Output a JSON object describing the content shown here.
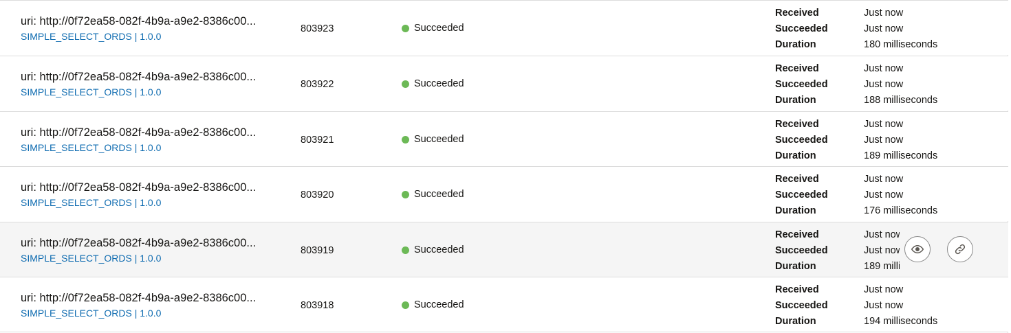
{
  "rows": [
    {
      "uri": "uri: http://0f72ea58-082f-4b9a-a9e2-8386c00...",
      "module": "SIMPLE_SELECT_ORDS | 1.0.0",
      "id": "803923",
      "status": "Succeeded",
      "received_label": "Received",
      "received": "Just now",
      "succeeded_label": "Succeeded",
      "succeeded": "Just now",
      "duration_label": "Duration",
      "duration": "180 milliseconds"
    },
    {
      "uri": "uri: http://0f72ea58-082f-4b9a-a9e2-8386c00...",
      "module": "SIMPLE_SELECT_ORDS | 1.0.0",
      "id": "803922",
      "status": "Succeeded",
      "received_label": "Received",
      "received": "Just now",
      "succeeded_label": "Succeeded",
      "succeeded": "Just now",
      "duration_label": "Duration",
      "duration": "188 milliseconds"
    },
    {
      "uri": "uri: http://0f72ea58-082f-4b9a-a9e2-8386c00...",
      "module": "SIMPLE_SELECT_ORDS | 1.0.0",
      "id": "803921",
      "status": "Succeeded",
      "received_label": "Received",
      "received": "Just now",
      "succeeded_label": "Succeeded",
      "succeeded": "Just now",
      "duration_label": "Duration",
      "duration": "189 milliseconds"
    },
    {
      "uri": "uri: http://0f72ea58-082f-4b9a-a9e2-8386c00...",
      "module": "SIMPLE_SELECT_ORDS | 1.0.0",
      "id": "803920",
      "status": "Succeeded",
      "received_label": "Received",
      "received": "Just now",
      "succeeded_label": "Succeeded",
      "succeeded": "Just now",
      "duration_label": "Duration",
      "duration": "176 milliseconds"
    },
    {
      "uri": "uri: http://0f72ea58-082f-4b9a-a9e2-8386c00...",
      "module": "SIMPLE_SELECT_ORDS | 1.0.0",
      "id": "803919",
      "status": "Succeeded",
      "received_label": "Received",
      "received": "Just now",
      "succeeded_label": "Succeeded",
      "succeeded": "Just now",
      "duration_label": "Duration",
      "duration": "189 milliseconds"
    },
    {
      "uri": "uri: http://0f72ea58-082f-4b9a-a9e2-8386c00...",
      "module": "SIMPLE_SELECT_ORDS | 1.0.0",
      "id": "803918",
      "status": "Succeeded",
      "received_label": "Received",
      "received": "Just now",
      "succeeded_label": "Succeeded",
      "succeeded": "Just now",
      "duration_label": "Duration",
      "duration": "194 milliseconds"
    }
  ],
  "row_actions": {
    "view_icon": "eye-icon",
    "link_icon": "link-icon"
  },
  "colors": {
    "status_success": "#6cb956",
    "link": "#0e6bb0",
    "hover_row": "#f5f5f5",
    "divider": "#dcdcdc"
  }
}
